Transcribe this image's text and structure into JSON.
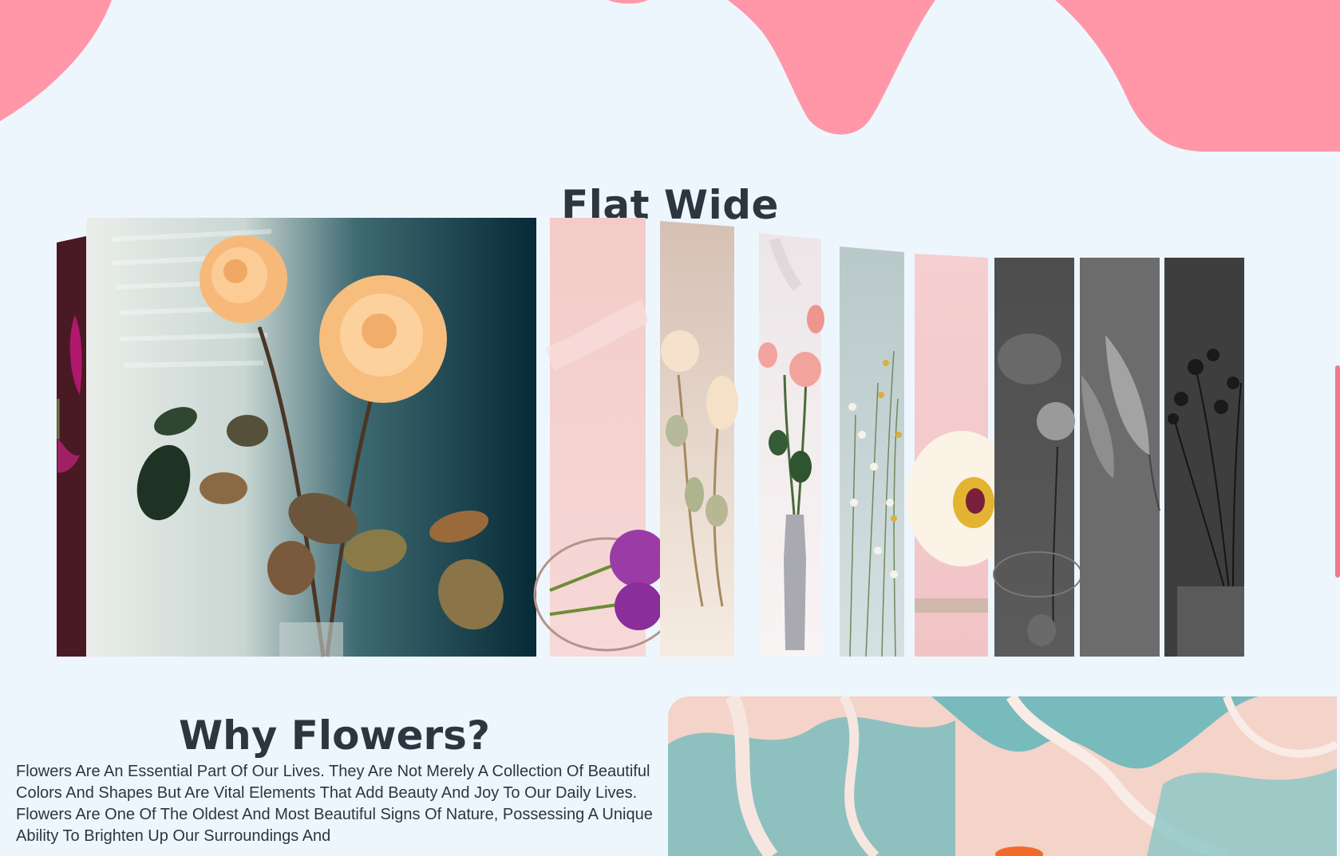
{
  "colors": {
    "background": "#eef6fd",
    "blob": "#ff97a9",
    "heading": "#2d3640",
    "accent": "#f0788e"
  },
  "gallery": {
    "title": "Flat Wide"
  },
  "why": {
    "title": "Why Flowers?",
    "body": "Flowers Are An Essential Part Of Our Lives. They Are Not Merely A Collection Of Beautiful Colors And Shapes But Are Vital Elements That Add Beauty And Joy To Our Daily Lives. Flowers Are One Of The Oldest And Most Beautiful Signs Of Nature, Possessing A Unique Ability To Brighten Up Our Surroundings And"
  },
  "icons": {
    "scrollbar": "vertical-scroll-indicator"
  }
}
